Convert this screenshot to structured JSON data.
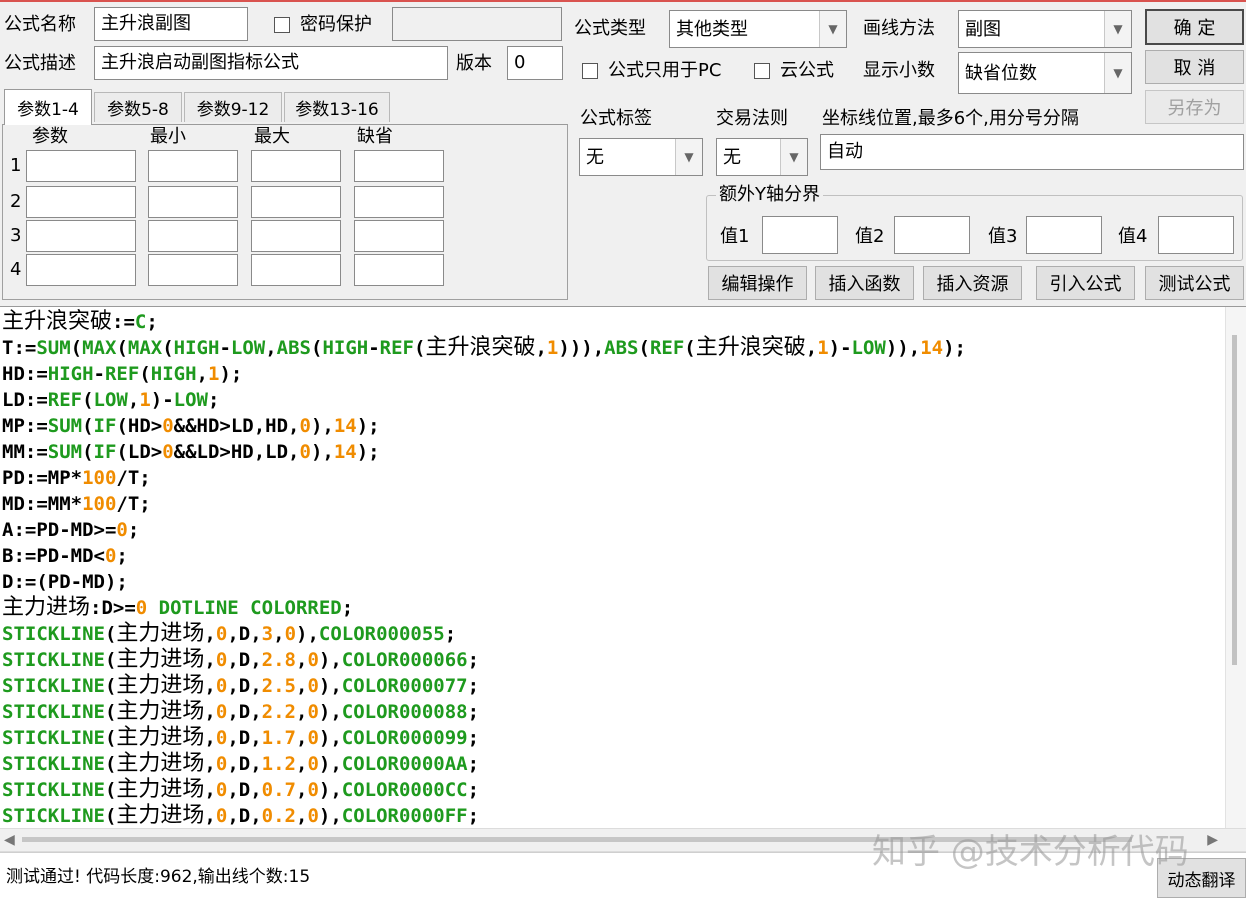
{
  "form": {
    "name_label": "公式名称",
    "name_value": "主升浪副图",
    "password_label": "密码保护",
    "password_checked": false,
    "password_value": "",
    "desc_label": "公式描述",
    "desc_value": "主升浪启动副图指标公式",
    "version_label": "版本",
    "version_value": "0",
    "type_label": "公式类型",
    "type_value": "其他类型",
    "draw_label": "画线方法",
    "draw_value": "副图",
    "pc_only_label": "公式只用于PC",
    "pc_only_checked": false,
    "cloud_label": "云公式",
    "cloud_checked": false,
    "decimal_label": "显示小数",
    "decimal_value": "缺省位数",
    "tag_label": "公式标签",
    "tag_value": "无",
    "rule_label": "交易法则",
    "rule_value": "无",
    "axis_label": "坐标线位置,最多6个,用分号分隔",
    "axis_value": "自动",
    "extra_y_label": "额外Y轴分界",
    "extra_y": [
      {
        "label": "值1",
        "value": ""
      },
      {
        "label": "值2",
        "value": ""
      },
      {
        "label": "值3",
        "value": ""
      },
      {
        "label": "值4",
        "value": ""
      }
    ]
  },
  "buttons": {
    "ok": "确  定",
    "cancel": "取  消",
    "save_as": "另存为",
    "edit_ops": "编辑操作",
    "insert_func": "插入函数",
    "insert_res": "插入资源",
    "import_formula": "引入公式",
    "test_formula": "测试公式",
    "dyn_translate": "动态翻译"
  },
  "params": {
    "tabs": [
      "参数1-4",
      "参数5-8",
      "参数9-12",
      "参数13-16"
    ],
    "active_tab": 0,
    "headers": [
      "参数",
      "最小",
      "最大",
      "缺省"
    ],
    "rows": [
      {
        "num": "1"
      },
      {
        "num": "2"
      },
      {
        "num": "3"
      },
      {
        "num": "4"
      }
    ]
  },
  "code_lines": [
    [
      [
        "z",
        "主升浪突破"
      ],
      [
        "t",
        ":="
      ],
      [
        "k",
        "C"
      ],
      [
        "t",
        ";"
      ]
    ],
    [
      [
        "t",
        "T:="
      ],
      [
        "k",
        "SUM"
      ],
      [
        "t",
        "("
      ],
      [
        "k",
        "MAX"
      ],
      [
        "t",
        "("
      ],
      [
        "k",
        "MAX"
      ],
      [
        "t",
        "("
      ],
      [
        "k",
        "HIGH"
      ],
      [
        "t",
        "-"
      ],
      [
        "k",
        "LOW"
      ],
      [
        "t",
        ","
      ],
      [
        "k",
        "ABS"
      ],
      [
        "t",
        "("
      ],
      [
        "k",
        "HIGH"
      ],
      [
        "t",
        "-"
      ],
      [
        "k",
        "REF"
      ],
      [
        "t",
        "("
      ],
      [
        "z",
        "主升浪突破"
      ],
      [
        "t",
        ","
      ],
      [
        "n",
        "1"
      ],
      [
        "t",
        ")))"
      ],
      [
        "t",
        ","
      ],
      [
        "k",
        "ABS"
      ],
      [
        "t",
        "("
      ],
      [
        "k",
        "REF"
      ],
      [
        "t",
        "("
      ],
      [
        "z",
        "主升浪突破"
      ],
      [
        "t",
        ","
      ],
      [
        "n",
        "1"
      ],
      [
        "t",
        ")-"
      ],
      [
        "k",
        "LOW"
      ],
      [
        "t",
        "))"
      ],
      [
        "t",
        ","
      ],
      [
        "n",
        "14"
      ],
      [
        "t",
        ");"
      ]
    ],
    [
      [
        "t",
        "HD:="
      ],
      [
        "k",
        "HIGH"
      ],
      [
        "t",
        "-"
      ],
      [
        "k",
        "REF"
      ],
      [
        "t",
        "("
      ],
      [
        "k",
        "HIGH"
      ],
      [
        "t",
        ","
      ],
      [
        "n",
        "1"
      ],
      [
        "t",
        ");"
      ]
    ],
    [
      [
        "t",
        "LD:="
      ],
      [
        "k",
        "REF"
      ],
      [
        "t",
        "("
      ],
      [
        "k",
        "LOW"
      ],
      [
        "t",
        ","
      ],
      [
        "n",
        "1"
      ],
      [
        "t",
        ")-"
      ],
      [
        "k",
        "LOW"
      ],
      [
        "t",
        ";"
      ]
    ],
    [
      [
        "t",
        "MP:="
      ],
      [
        "k",
        "SUM"
      ],
      [
        "t",
        "("
      ],
      [
        "k",
        "IF"
      ],
      [
        "t",
        "(HD>"
      ],
      [
        "n",
        "0"
      ],
      [
        "t",
        "&&HD>LD,HD,"
      ],
      [
        "n",
        "0"
      ],
      [
        "t",
        "),"
      ],
      [
        "n",
        "14"
      ],
      [
        "t",
        ");"
      ]
    ],
    [
      [
        "t",
        "MM:="
      ],
      [
        "k",
        "SUM"
      ],
      [
        "t",
        "("
      ],
      [
        "k",
        "IF"
      ],
      [
        "t",
        "(LD>"
      ],
      [
        "n",
        "0"
      ],
      [
        "t",
        "&&LD>HD,LD,"
      ],
      [
        "n",
        "0"
      ],
      [
        "t",
        "),"
      ],
      [
        "n",
        "14"
      ],
      [
        "t",
        ");"
      ]
    ],
    [
      [
        "t",
        "PD:=MP*"
      ],
      [
        "n",
        "100"
      ],
      [
        "t",
        "/T;"
      ]
    ],
    [
      [
        "t",
        "MD:=MM*"
      ],
      [
        "n",
        "100"
      ],
      [
        "t",
        "/T;"
      ]
    ],
    [
      [
        "t",
        "A:=PD-MD>="
      ],
      [
        "n",
        "0"
      ],
      [
        "t",
        ";"
      ]
    ],
    [
      [
        "t",
        "B:=PD-MD<"
      ],
      [
        "n",
        "0"
      ],
      [
        "t",
        ";"
      ]
    ],
    [
      [
        "t",
        "D:=(PD-MD);"
      ]
    ],
    [
      [
        "z",
        "主力进场"
      ],
      [
        "t",
        ":D>="
      ],
      [
        "n",
        "0"
      ],
      [
        "k",
        " DOTLINE COLORRED"
      ],
      [
        "t",
        ";"
      ]
    ],
    [
      [
        "k",
        "STICKLINE"
      ],
      [
        "t",
        "("
      ],
      [
        "z",
        "主力进场"
      ],
      [
        "t",
        ","
      ],
      [
        "n",
        "0"
      ],
      [
        "t",
        ",D,"
      ],
      [
        "n",
        "3"
      ],
      [
        "t",
        ","
      ],
      [
        "n",
        "0"
      ],
      [
        "t",
        "),"
      ],
      [
        "k",
        "COLOR000055"
      ],
      [
        "t",
        ";"
      ]
    ],
    [
      [
        "k",
        "STICKLINE"
      ],
      [
        "t",
        "("
      ],
      [
        "z",
        "主力进场"
      ],
      [
        "t",
        ","
      ],
      [
        "n",
        "0"
      ],
      [
        "t",
        ",D,"
      ],
      [
        "n",
        "2.8"
      ],
      [
        "t",
        ","
      ],
      [
        "n",
        "0"
      ],
      [
        "t",
        "),"
      ],
      [
        "k",
        "COLOR000066"
      ],
      [
        "t",
        ";"
      ]
    ],
    [
      [
        "k",
        "STICKLINE"
      ],
      [
        "t",
        "("
      ],
      [
        "z",
        "主力进场"
      ],
      [
        "t",
        ","
      ],
      [
        "n",
        "0"
      ],
      [
        "t",
        ",D,"
      ],
      [
        "n",
        "2.5"
      ],
      [
        "t",
        ","
      ],
      [
        "n",
        "0"
      ],
      [
        "t",
        "),"
      ],
      [
        "k",
        "COLOR000077"
      ],
      [
        "t",
        ";"
      ]
    ],
    [
      [
        "k",
        "STICKLINE"
      ],
      [
        "t",
        "("
      ],
      [
        "z",
        "主力进场"
      ],
      [
        "t",
        ","
      ],
      [
        "n",
        "0"
      ],
      [
        "t",
        ",D,"
      ],
      [
        "n",
        "2.2"
      ],
      [
        "t",
        ","
      ],
      [
        "n",
        "0"
      ],
      [
        "t",
        "),"
      ],
      [
        "k",
        "COLOR000088"
      ],
      [
        "t",
        ";"
      ]
    ],
    [
      [
        "k",
        "STICKLINE"
      ],
      [
        "t",
        "("
      ],
      [
        "z",
        "主力进场"
      ],
      [
        "t",
        ","
      ],
      [
        "n",
        "0"
      ],
      [
        "t",
        ",D,"
      ],
      [
        "n",
        "1.7"
      ],
      [
        "t",
        ","
      ],
      [
        "n",
        "0"
      ],
      [
        "t",
        "),"
      ],
      [
        "k",
        "COLOR000099"
      ],
      [
        "t",
        ";"
      ]
    ],
    [
      [
        "k",
        "STICKLINE"
      ],
      [
        "t",
        "("
      ],
      [
        "z",
        "主力进场"
      ],
      [
        "t",
        ","
      ],
      [
        "n",
        "0"
      ],
      [
        "t",
        ",D,"
      ],
      [
        "n",
        "1.2"
      ],
      [
        "t",
        ","
      ],
      [
        "n",
        "0"
      ],
      [
        "t",
        "),"
      ],
      [
        "k",
        "COLOR0000AA"
      ],
      [
        "t",
        ";"
      ]
    ],
    [
      [
        "k",
        "STICKLINE"
      ],
      [
        "t",
        "("
      ],
      [
        "z",
        "主力进场"
      ],
      [
        "t",
        ","
      ],
      [
        "n",
        "0"
      ],
      [
        "t",
        ",D,"
      ],
      [
        "n",
        "0.7"
      ],
      [
        "t",
        ","
      ],
      [
        "n",
        "0"
      ],
      [
        "t",
        "),"
      ],
      [
        "k",
        "COLOR0000CC"
      ],
      [
        "t",
        ";"
      ]
    ],
    [
      [
        "k",
        "STICKLINE"
      ],
      [
        "t",
        "("
      ],
      [
        "z",
        "主力进场"
      ],
      [
        "t",
        ","
      ],
      [
        "n",
        "0"
      ],
      [
        "t",
        ",D,"
      ],
      [
        "n",
        "0.2"
      ],
      [
        "t",
        ","
      ],
      [
        "n",
        "0"
      ],
      [
        "t",
        "),"
      ],
      [
        "k",
        "COLOR0000FF"
      ],
      [
        "t",
        ";"
      ]
    ]
  ],
  "status": {
    "text": "测试通过! 代码长度:962,输出线个数:15"
  },
  "watermark": "知乎 @技术分析代码",
  "colors": {
    "keyword": "#1e9a1e",
    "number": "#f08c00",
    "text": "#000000",
    "background": "#f0f0f0"
  },
  "icons": {
    "dropdown": "chevron-down-icon",
    "scroll_left": "arrow-left-icon",
    "scroll_right": "arrow-right-icon"
  }
}
